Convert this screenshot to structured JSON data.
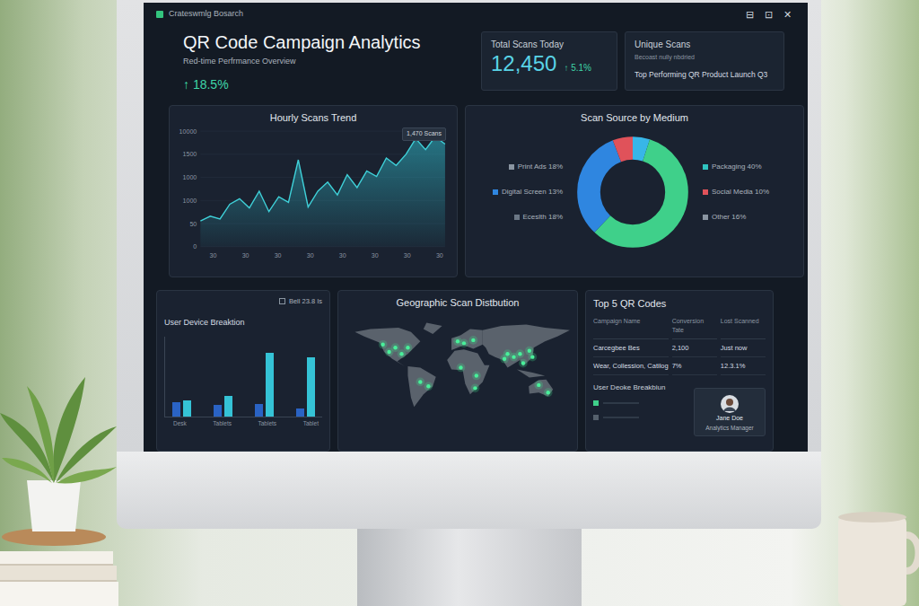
{
  "window": {
    "title": "Crateswmlg Bosarch",
    "controls": [
      "⊟",
      "⊡",
      "✕"
    ]
  },
  "header": {
    "title": "QR Code Campaign Analytics",
    "subtitle": "Red-time Perfrmance Overview",
    "change": "↑ 18.5%"
  },
  "kpis": [
    {
      "kind": "metric",
      "label": "Total Scans Today",
      "value": "12,450",
      "change": "↑ 5.1%"
    },
    {
      "kind": "text",
      "label": "Unique Scans",
      "note": "Becoast nully nbdried",
      "value": "Top Performing QR Product Launch Q3"
    }
  ],
  "hourly_chart": {
    "title": "Hourly Scans Trend",
    "y_ticks": [
      "10000",
      "1500",
      "1000",
      "1000",
      "50",
      "0"
    ],
    "x_ticks": [
      "30",
      "30",
      "30",
      "30",
      "30",
      "30",
      "30",
      "30"
    ],
    "tooltip": "1,470 Scans",
    "series": [
      {
        "values": [
          280,
          330,
          300,
          460,
          520,
          420,
          600,
          380,
          540,
          480,
          940,
          430,
          600,
          700,
          560,
          780,
          640,
          820,
          760,
          960,
          880,
          1000,
          1170,
          1050,
          1190,
          1110
        ]
      }
    ]
  },
  "source_chart": {
    "title": "Scan Source by Medium",
    "segments": [
      {
        "value": 5,
        "color": "#38b6e8"
      },
      {
        "value": 57,
        "color": "#3fd08a"
      },
      {
        "value": 32,
        "color": "#2f86e0"
      },
      {
        "value": 6,
        "color": "#e0525a"
      }
    ],
    "legend_left": [
      {
        "label": "Print Ads 18%",
        "color": "#8a95a1"
      },
      {
        "label": "Digital Screen 13%",
        "color": "#2f86e0"
      },
      {
        "label": "Eceslth 18%",
        "color": "#6b7785"
      }
    ],
    "legend_right": [
      {
        "label": "Packaging 40%",
        "color": "#2fc4c0"
      },
      {
        "label": "Social Media 10%",
        "color": "#e0525a"
      },
      {
        "label": "Other 16%",
        "color": "#8a95a1"
      }
    ]
  },
  "device_chart": {
    "title": "User Device Breaktion",
    "badge": "Bell 23.8 Is",
    "categories": [
      "Desk",
      "Tablets",
      "Tablets",
      "Tablet"
    ],
    "series": [
      {
        "color": "#2a63c4",
        "values": [
          18,
          14,
          16,
          10
        ]
      },
      {
        "color": "#35c3d6",
        "values": [
          20,
          26,
          80,
          74
        ]
      }
    ]
  },
  "map": {
    "title": "Geographic Scan Distbution",
    "pins": [
      {
        "lon": -120,
        "lat": 45
      },
      {
        "lon": -100,
        "lat": 40
      },
      {
        "lon": -80,
        "lat": 40
      },
      {
        "lon": -90,
        "lat": 30
      },
      {
        "lon": -110,
        "lat": 33
      },
      {
        "lon": -60,
        "lat": -15
      },
      {
        "lon": -47,
        "lat": -22
      },
      {
        "lon": 0,
        "lat": 50
      },
      {
        "lon": 10,
        "lat": 47
      },
      {
        "lon": 25,
        "lat": 52
      },
      {
        "lon": 5,
        "lat": 8
      },
      {
        "lon": 30,
        "lat": -5
      },
      {
        "lon": 28,
        "lat": -25
      },
      {
        "lon": 75,
        "lat": 22
      },
      {
        "lon": 80,
        "lat": 30
      },
      {
        "lon": 100,
        "lat": 30
      },
      {
        "lon": 115,
        "lat": 35
      },
      {
        "lon": 105,
        "lat": 15
      },
      {
        "lon": 90,
        "lat": 25
      },
      {
        "lon": 120,
        "lat": 25
      },
      {
        "lon": 145,
        "lat": -32
      },
      {
        "lon": 130,
        "lat": -20
      }
    ]
  },
  "top_codes": {
    "title": "Top 5 QR Codes",
    "columns": [
      "Campaign Name",
      "Conversion Tate",
      "Lost Scanned"
    ],
    "rows": [
      [
        "Carcegbee Bes",
        "2,100",
        "Just now"
      ],
      [
        "Wear, Collession, Catilog",
        "7%",
        "12.3.1%"
      ]
    ],
    "subtitle": "User Deoke Breakbiun",
    "items": [
      {
        "color": "#3fd08a"
      },
      {
        "color": "#55606c"
      }
    ],
    "user": {
      "name": "Jane Doe",
      "role": "Analytics Manager"
    }
  }
}
